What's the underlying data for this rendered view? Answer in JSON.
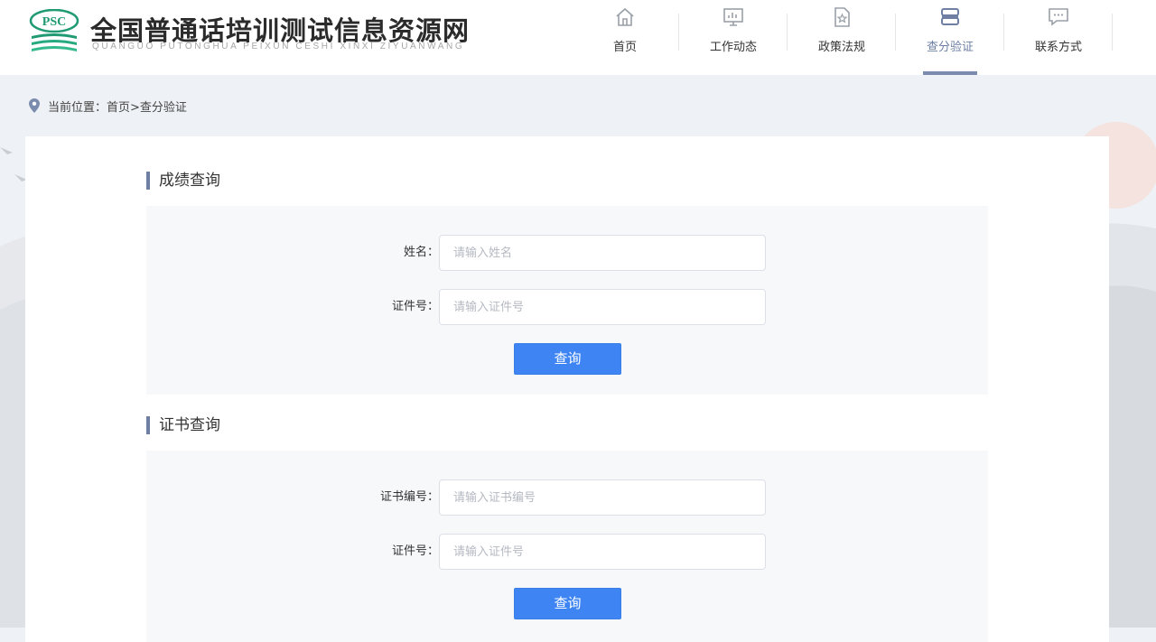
{
  "header": {
    "logo_text": "PSC",
    "site_title": "全国普通话培训测试信息资源网",
    "site_subtitle": "QUANGUO PUTONGHUA PEIXUN CESHI XINXI ZIYUANWANG",
    "nav": [
      {
        "label": "首页",
        "icon": "home-icon",
        "active": false
      },
      {
        "label": "工作动态",
        "icon": "presentation-icon",
        "active": false
      },
      {
        "label": "政策法规",
        "icon": "document-star-icon",
        "active": false
      },
      {
        "label": "查分验证",
        "icon": "books-icon",
        "active": true
      },
      {
        "label": "联系方式",
        "icon": "chat-icon",
        "active": false
      }
    ],
    "accent_color": "#6e7fa3"
  },
  "breadcrumb": {
    "icon": "location-pin-icon",
    "text": "当前位置：首页>查分验证"
  },
  "score_query": {
    "title": "成绩查询",
    "name_label": "姓名：",
    "name_value": "",
    "name_placeholder": "请输入姓名",
    "id_label": "证件号：",
    "id_value": "",
    "id_placeholder": "请输入证件号",
    "button_label": "查询"
  },
  "cert_query": {
    "title": "证书查询",
    "cert_no_label": "证书编号：",
    "cert_no_value": "",
    "cert_no_placeholder": "请输入证书编号",
    "id_label": "证件号：",
    "id_value": "",
    "id_placeholder": "请输入证件号",
    "button_label": "查询"
  },
  "colors": {
    "button": "#3e85f3",
    "page_background": "#eef1f5"
  }
}
